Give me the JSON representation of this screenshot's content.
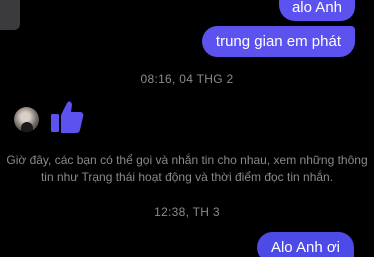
{
  "colors": {
    "background": "#000000",
    "bubble_accent": "#5b52f0",
    "bubble_accent_alt": "#4d4be8",
    "muted_text": "#8a8a8e"
  },
  "messages": [
    {
      "text": "alo Anh",
      "sender": "self"
    },
    {
      "text": "trung gian em phát",
      "sender": "self"
    },
    {
      "text": "Alo Anh ơi",
      "sender": "self"
    }
  ],
  "timestamps": [
    "08:16, 04 THG 2",
    "12:38, TH 3"
  ],
  "contact_reaction": {
    "icon": "thumbs-up-icon"
  },
  "notice": "Giờ đây, các bạn có thể gọi và nhắn tin cho nhau, xem những thông tin như Trạng thái hoạt động và thời điểm đọc tin nhắn."
}
